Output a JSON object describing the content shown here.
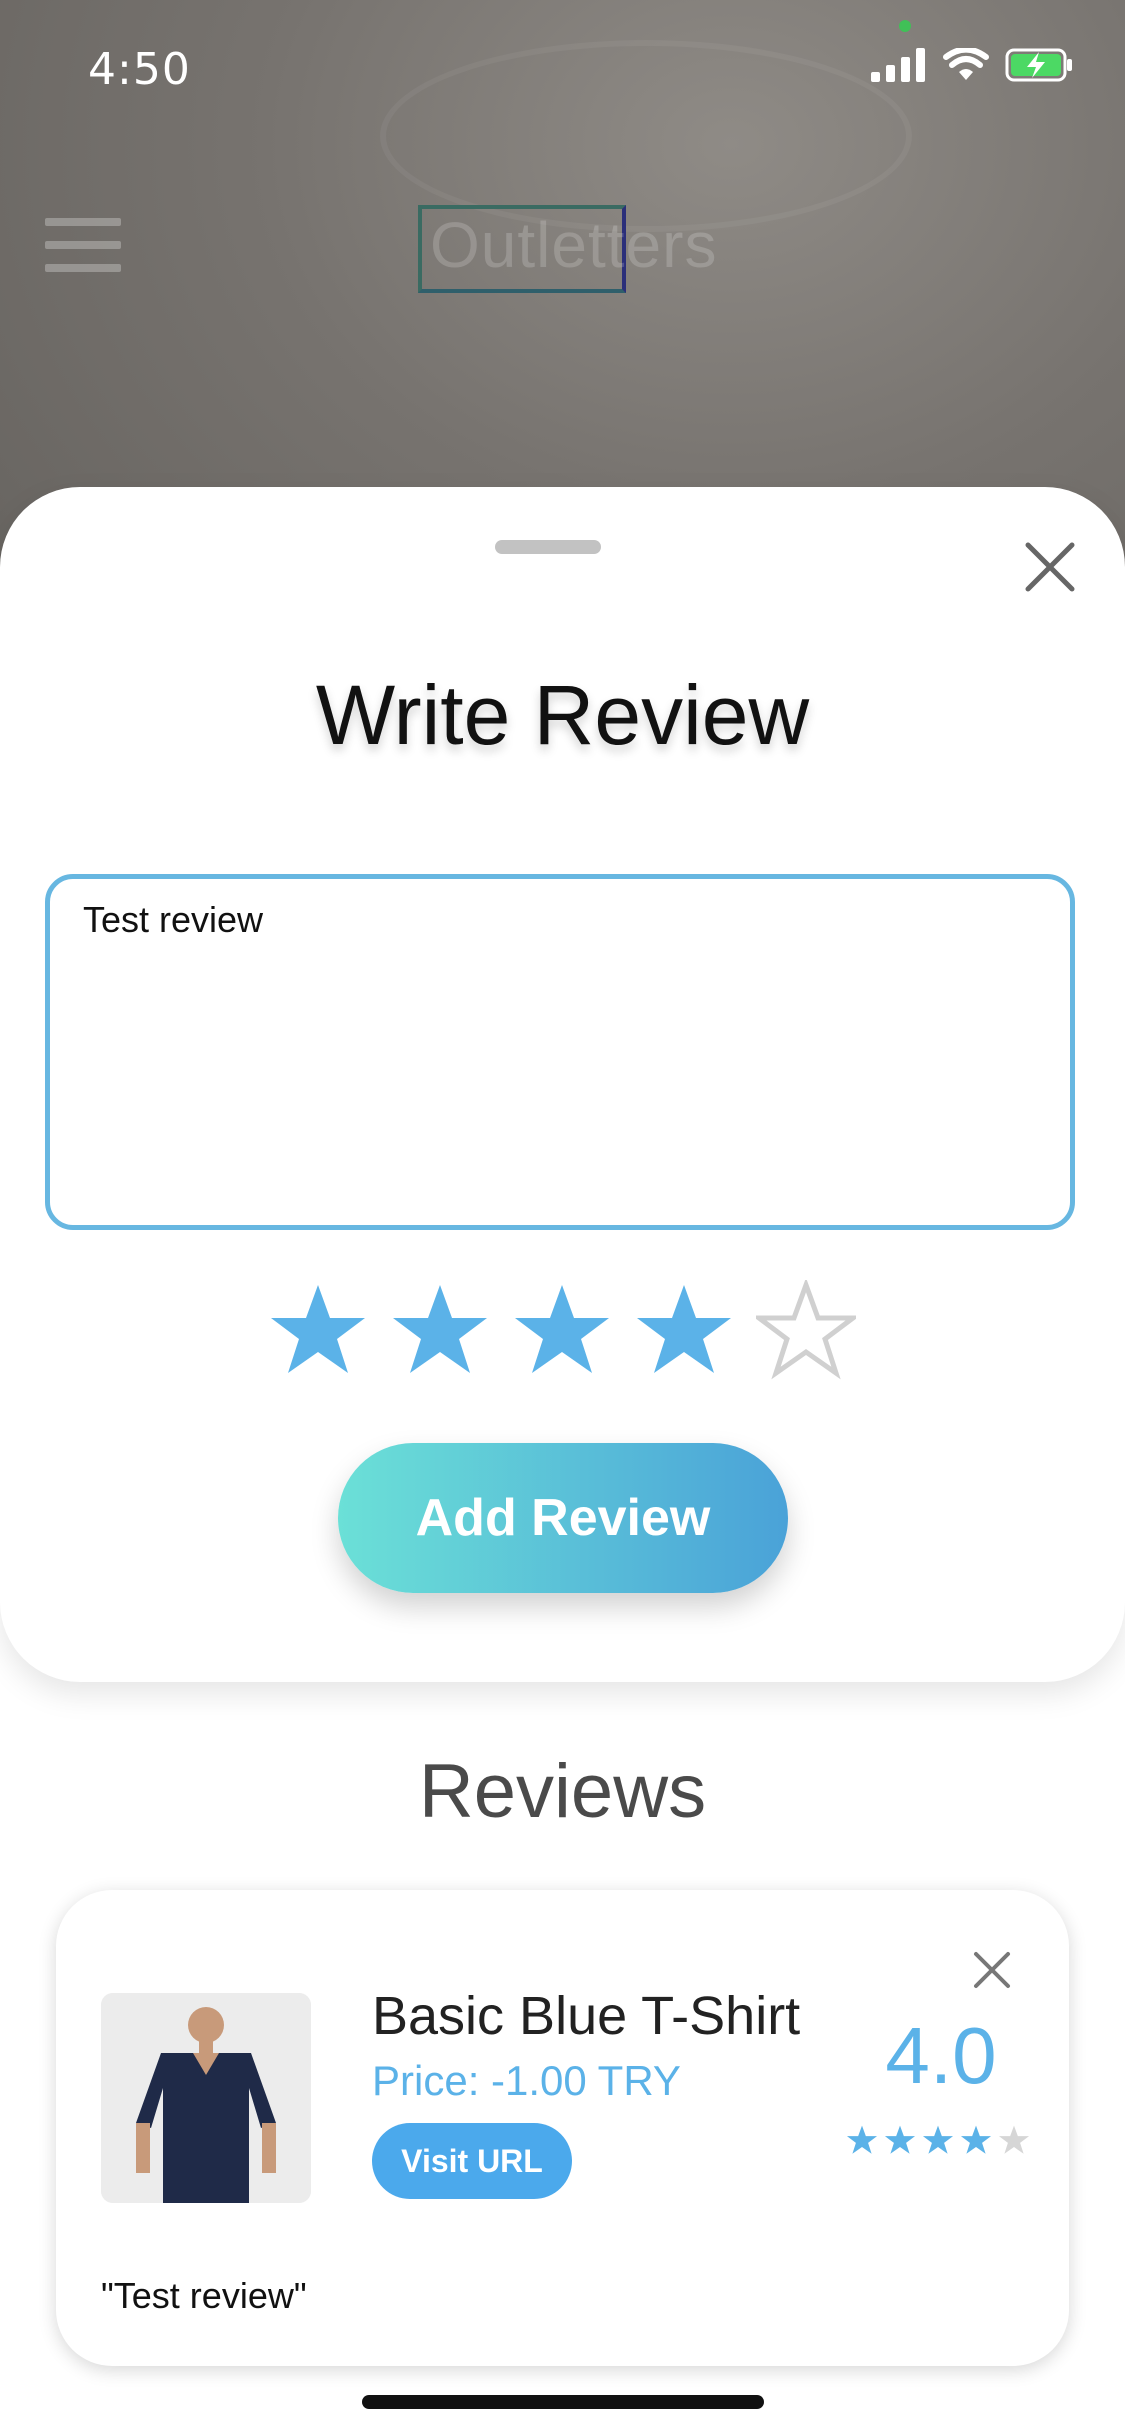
{
  "status_bar": {
    "time": "4:50",
    "icons": [
      "cellular-signal-icon",
      "wifi-icon",
      "battery-charging-icon"
    ],
    "battery_color": "#4cd964"
  },
  "header": {
    "logo_text": "Outletters",
    "menu_icon": "hamburger-menu-icon"
  },
  "sheet": {
    "title": "Write Review",
    "review_text": "Test review",
    "rating": 4,
    "max_rating": 5,
    "submit_label": "Add Review",
    "accent_color": "#67b7e1"
  },
  "reviews": {
    "title": "Reviews",
    "items": [
      {
        "product_name": "Basic Blue T-Shirt",
        "price": "Price: -1.00 TRY",
        "visit_label": "Visit URL",
        "rating": "4.0",
        "stars": 4,
        "quote": "\"Test review\""
      }
    ]
  }
}
